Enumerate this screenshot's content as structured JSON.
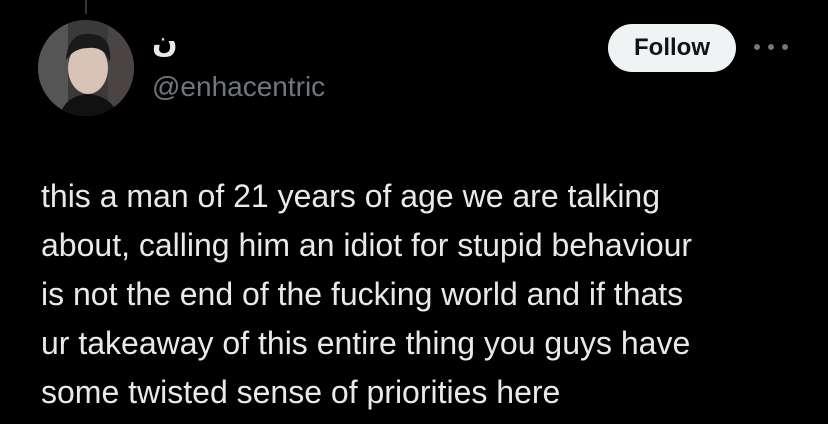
{
  "author": {
    "display_name": "ن",
    "handle": "@enhacentric"
  },
  "actions": {
    "follow_label": "Follow",
    "more_icon": "more-horizontal-icon"
  },
  "tweet": {
    "text": "this a man of 21 years of age we are talking\nabout, calling him an idiot for stupid behaviour\nis not the end of the fucking world and if thats\nur takeaway of this entire thing you guys have\nsome twisted sense of priorities here"
  },
  "colors": {
    "background": "#000000",
    "text_primary": "#e7e9ea",
    "text_secondary": "#71767b",
    "follow_button_bg": "#eff3f4",
    "follow_button_text": "#0f1419"
  }
}
